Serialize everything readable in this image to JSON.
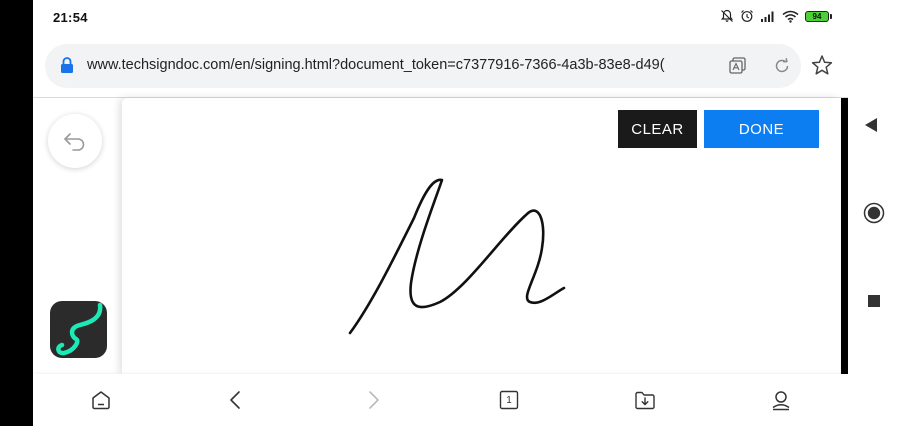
{
  "status_bar": {
    "time": "21:54",
    "battery_level": "94",
    "icons": [
      "bell-off-icon",
      "alarm-icon",
      "signal-icon",
      "wifi-icon",
      "battery-icon"
    ]
  },
  "browser": {
    "url": "www.techsigndoc.com/en/signing.html?document_token=c7377916-7366-4a3b-83e8-d49(",
    "icons": [
      "lock-icon",
      "translate-icon",
      "reload-icon",
      "star-icon"
    ]
  },
  "signature_pad": {
    "clear_label": "CLEAR",
    "done_label": "DONE",
    "stroke_color": "#111111",
    "done_color": "#0d7ef2",
    "clear_color": "#1a1a1a"
  },
  "app_logo": {
    "accent_color": "#1de9b6"
  },
  "bottom_nav": {
    "tab_count": "1",
    "items": [
      "home-icon",
      "back-icon",
      "forward-icon",
      "tabs-icon",
      "downloads-icon",
      "profile-icon"
    ]
  },
  "system_nav": {
    "items": [
      "back-triangle-icon",
      "home-circle-icon",
      "recents-square-icon"
    ]
  }
}
